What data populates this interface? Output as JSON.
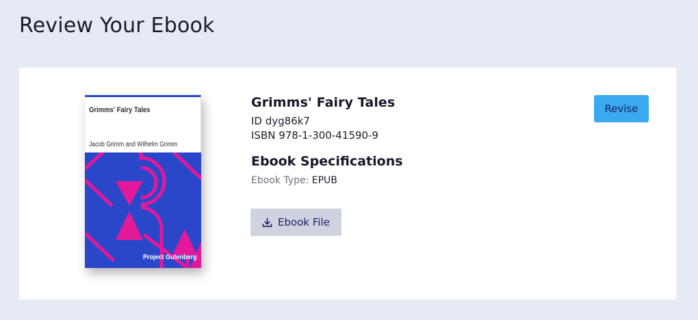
{
  "page": {
    "title": "Review Your Ebook"
  },
  "cover": {
    "title": "Grimms' Fairy Tales",
    "authors": "Jacob Grimm and Wilhelm Grimm",
    "publisher": "Project Gutenberg",
    "colors": {
      "background": "#2b47c9",
      "accent": "#e3199a"
    }
  },
  "book": {
    "title": "Grimms' Fairy Tales",
    "id_line": "ID dyg86k7",
    "isbn_line": "ISBN 978-1-300-41590-9"
  },
  "specs": {
    "heading": "Ebook Specifications",
    "type_label": "Ebook Type:",
    "type_value": "EPUB"
  },
  "actions": {
    "file_button_label": "Ebook File",
    "file_button_icon": "download-icon",
    "revise_label": "Revise"
  },
  "colors": {
    "page_background": "#e6eaf4",
    "card_background": "#ffffff",
    "revise_button": "#3aa9ee",
    "file_button": "#ced3df"
  }
}
